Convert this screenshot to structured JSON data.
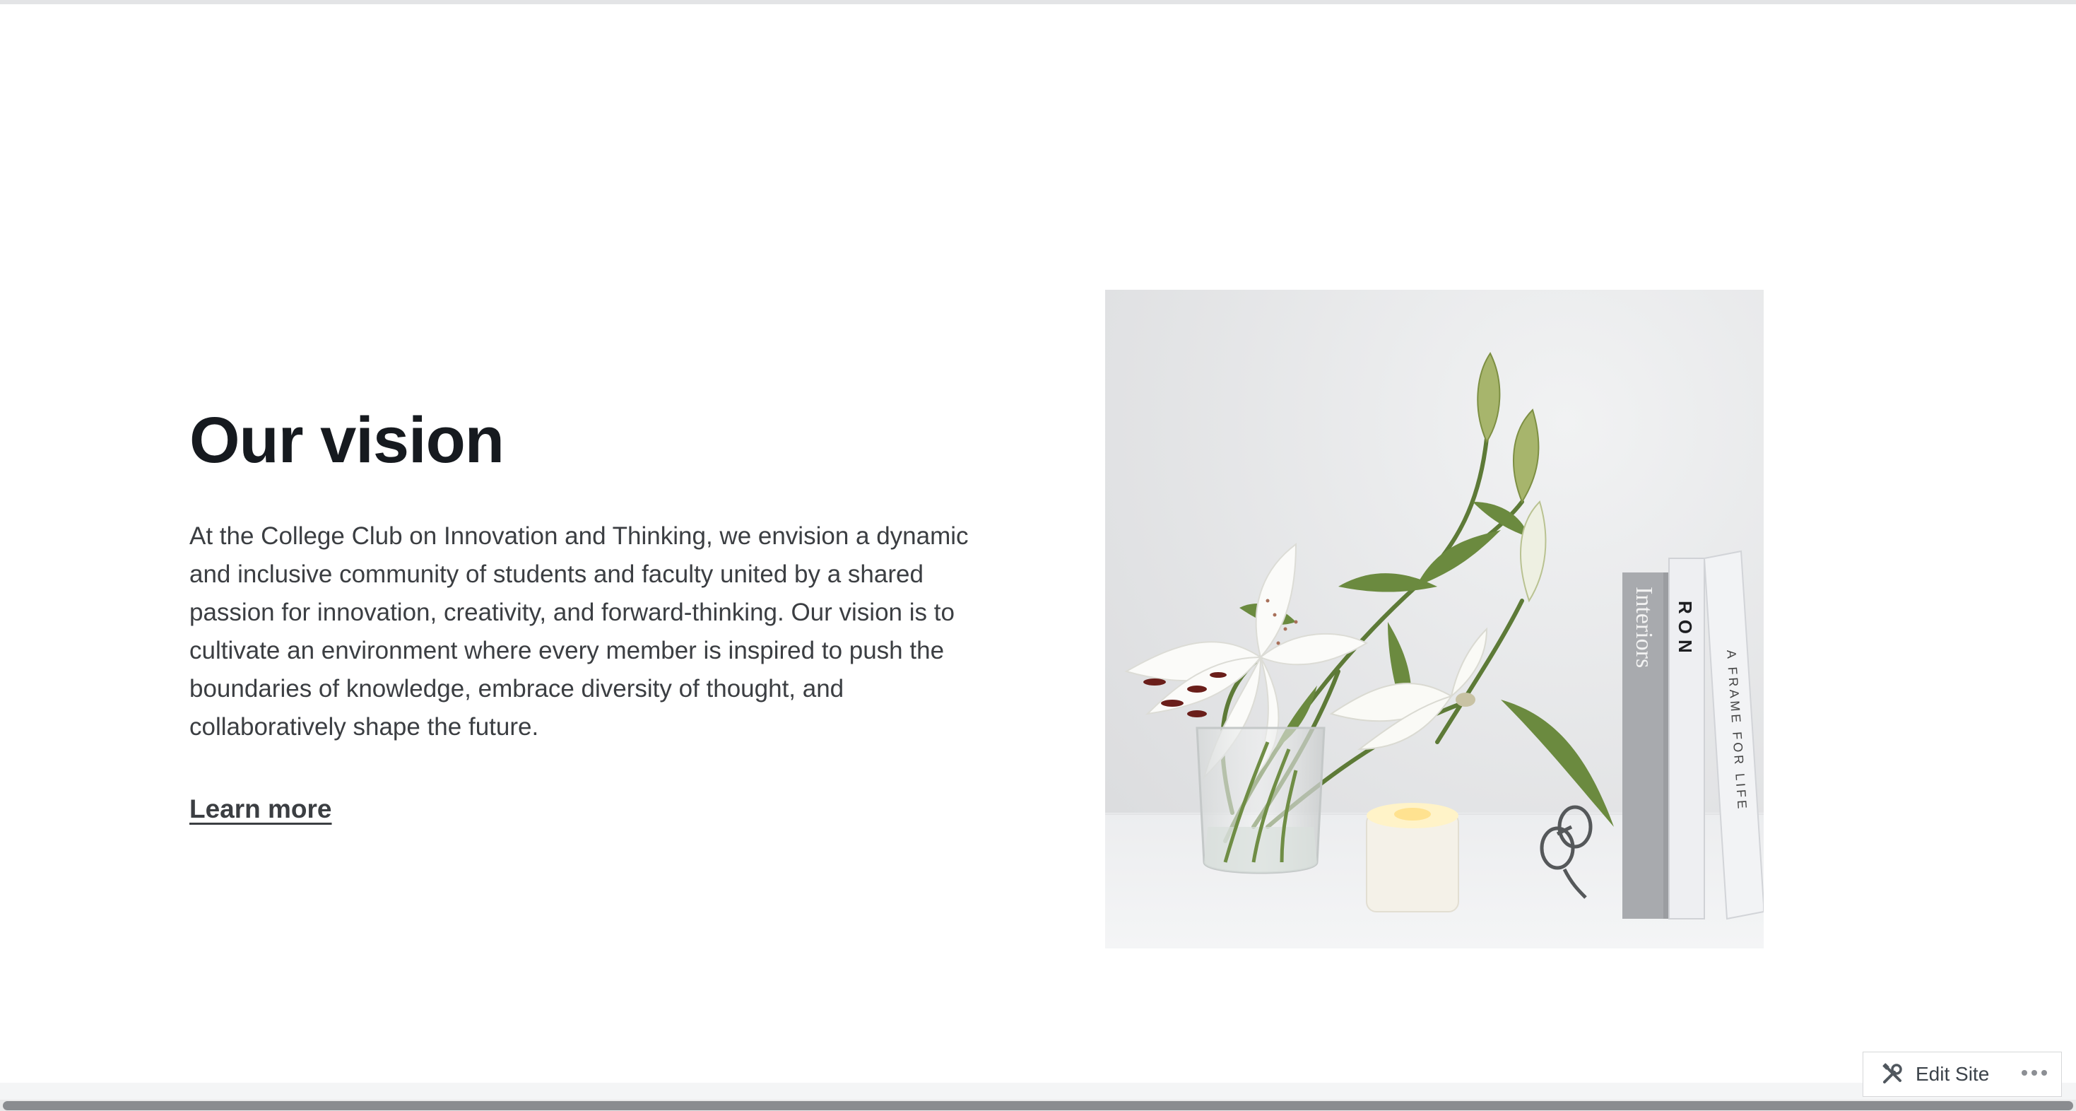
{
  "vision": {
    "heading": "Our vision",
    "body": "At the College Club on Innovation and Thinking, we envision a dynamic and inclusive community of students and faculty united by a shared passion for innovation, creativity, and forward-thinking. Our vision is to cultivate an environment where every member is inspired to push the boundaries of knowledge, embrace diversity of thought, and collaboratively shape the future.",
    "link_label": "Learn more"
  },
  "image": {
    "book_titles": [
      "Interiors",
      "RON",
      "A FRAME FOR LIFE"
    ]
  },
  "admin_bar": {
    "edit_site_label": "Edit Site",
    "edit_icon": "tools-icon",
    "more_icon": "ellipsis-icon"
  },
  "colors": {
    "heading": "#161a1f",
    "text": "#3b3e42",
    "photo_background": "#e6e7e9",
    "scrollbar": "#8a8c90"
  }
}
